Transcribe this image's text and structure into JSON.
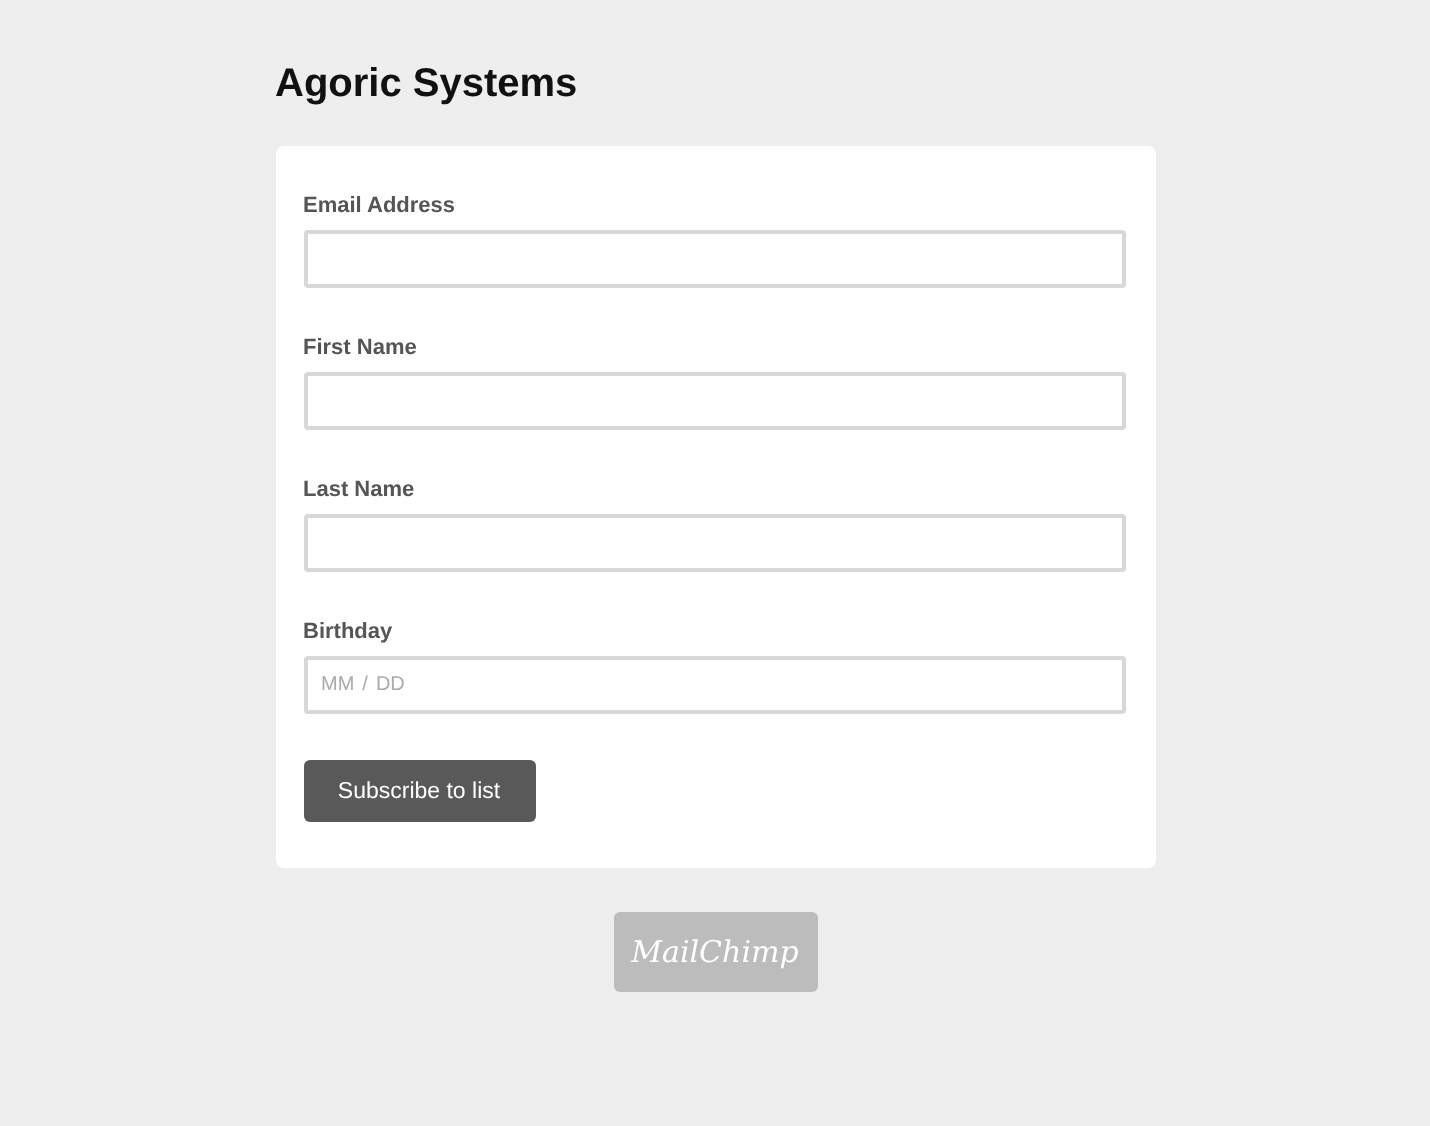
{
  "title": "Agoric Systems",
  "fields": [
    {
      "kind": "text",
      "label": "Email Address"
    },
    {
      "kind": "text",
      "label": "First Name"
    },
    {
      "kind": "text",
      "label": "Last Name"
    },
    {
      "kind": "date",
      "label": "Birthday",
      "segments": [
        "MM",
        "DD"
      ],
      "separator": "/"
    }
  ],
  "submit": "Subscribe to list",
  "badge": "MailChimp"
}
